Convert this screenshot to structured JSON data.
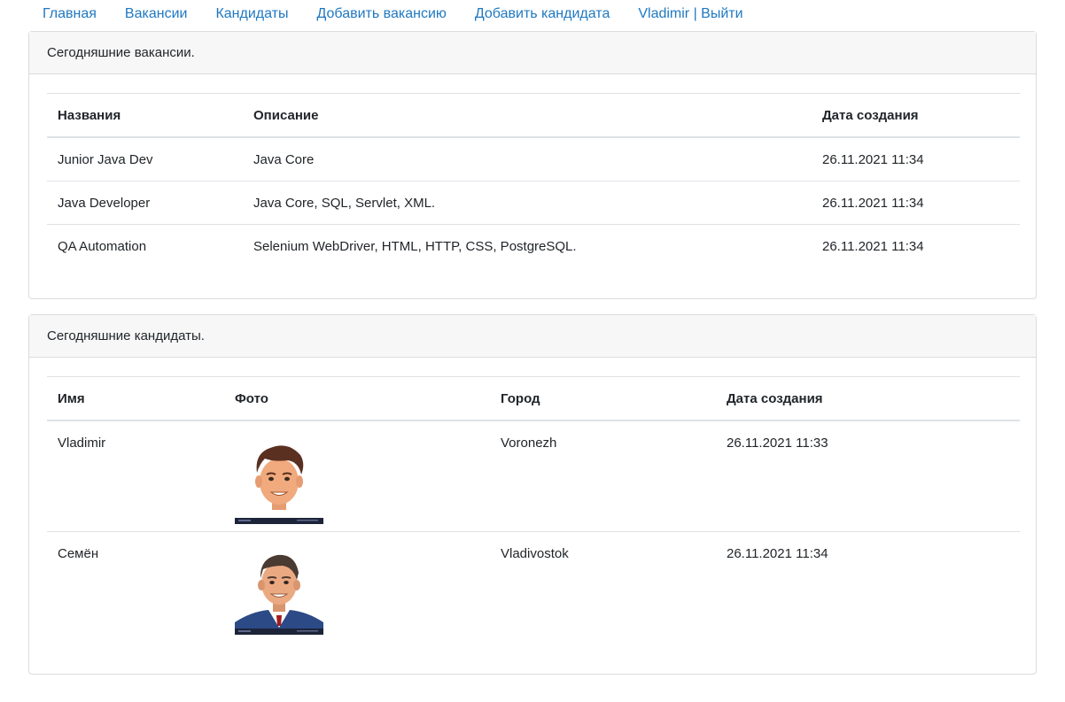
{
  "nav": [
    "Главная",
    "Вакансии",
    "Кандидаты",
    "Добавить вакансию",
    "Добавить кандидата",
    "Vladimir | Выйти"
  ],
  "vacancies": {
    "title": "Сегодняшние вакансии.",
    "headers": [
      "Названия",
      "Описание",
      "Дата создания"
    ],
    "rows": [
      [
        "Junior Java Dev",
        "Java Core",
        "26.11.2021 11:34"
      ],
      [
        "Java Developer",
        "Java Core, SQL, Servlet, XML.",
        "26.11.2021 11:34"
      ],
      [
        "QA Automation",
        "Selenium WebDriver, HTML, HTTP, CSS, PostgreSQL.",
        "26.11.2021 11:34"
      ]
    ]
  },
  "candidates": {
    "title": "Сегодняшние кандидаты.",
    "headers": [
      "Имя",
      "Фото",
      "Город",
      "Дата создания"
    ],
    "rows": [
      {
        "name": "Vladimir",
        "photo": "avatar-brown-hair",
        "city": "Voronezh",
        "created": "26.11.2021 11:33"
      },
      {
        "name": "Семён",
        "photo": "avatar-suit",
        "city": "Vladivostok",
        "created": "26.11.2021 11:34"
      }
    ]
  }
}
